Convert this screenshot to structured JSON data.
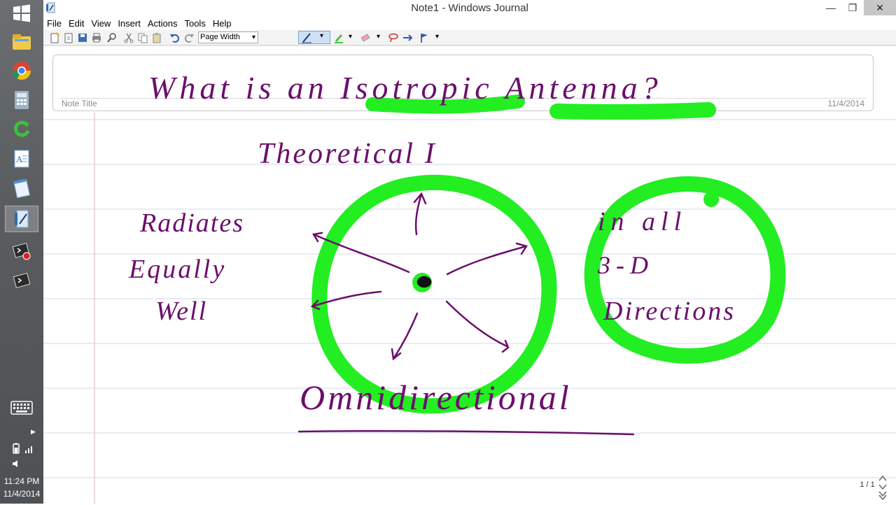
{
  "window": {
    "title": "Note1 - Windows Journal",
    "minimize_glyph": "—",
    "restore_glyph": "❐",
    "close_glyph": "✕"
  },
  "menu": [
    "File",
    "Edit",
    "View",
    "Insert",
    "Actions",
    "Tools",
    "Help"
  ],
  "toolbar": {
    "zoom_value": "Page Width",
    "dropdown_glyph": "▾"
  },
  "note": {
    "title_label": "Note Title",
    "date": "11/4/2014",
    "page_indicator": "1 / 1"
  },
  "handwriting": {
    "title": "What is an Isotropic Antenna?",
    "word1": "Theoretical I",
    "left_lines": [
      "Radiates",
      "Equally",
      "Well"
    ],
    "right_lines": [
      "in all",
      "3-D",
      "Directions"
    ],
    "bottom": "Omnidirectional"
  },
  "taskbar": {
    "time": "11:24 PM",
    "date": "11/4/2014",
    "icons": [
      "start-icon",
      "file-explorer-icon",
      "chrome-icon",
      "calculator-icon",
      "refresh-app-icon",
      "wordpad-icon",
      "notepad-icon",
      "journal-icon",
      "powershell-record-icon",
      "powershell-icon",
      "keyboard-icon",
      "battery-icon"
    ]
  },
  "colors": {
    "ink": "#6b0f6b",
    "highlighter": "#22ee22",
    "taskbar": "#5a5d60",
    "rule_lines": "#cfd8ea",
    "margin_line": "#d9b3b3"
  }
}
